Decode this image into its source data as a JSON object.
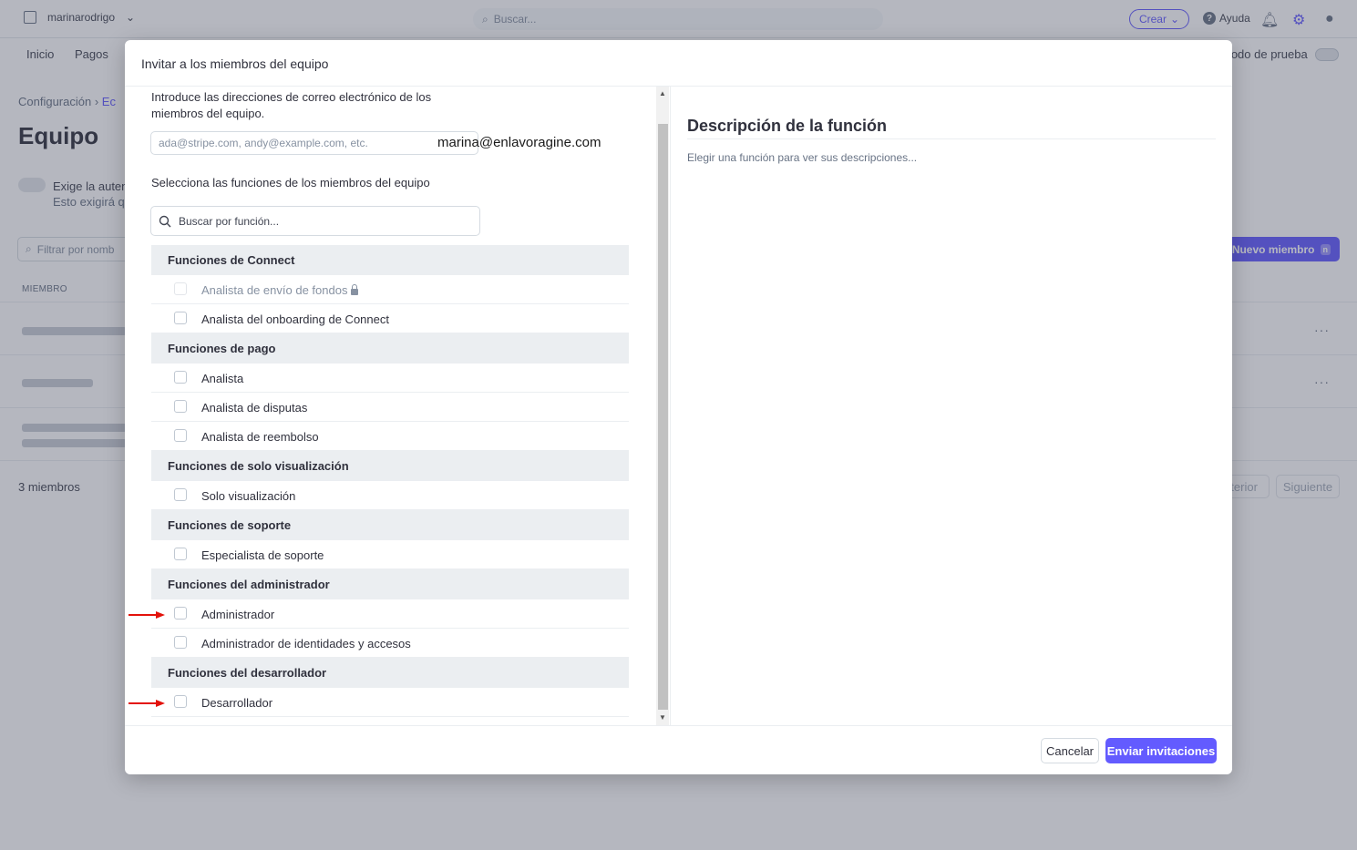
{
  "topbar": {
    "account_name": "marinarodrigo",
    "search_placeholder": "Buscar...",
    "create_label": "Crear",
    "help_label": "Ayuda"
  },
  "nav": {
    "items": [
      "Inicio",
      "Pagos"
    ],
    "test_mode_label": "Modo de prueba"
  },
  "page": {
    "breadcrumb_root": "Configuración",
    "breadcrumb_current": "Ec",
    "title": "Equipo",
    "auth_line1": "Exige la auten",
    "auth_line2": "Esto exigirá qu",
    "filter_placeholder": "Filtrar por nomb",
    "new_member_label": "Nuevo miembro",
    "new_member_shortcut": "n",
    "member_column": "MIEMBRO",
    "members_count": "3 miembros",
    "prev_label": "nterior",
    "next_label": "Siguiente"
  },
  "modal": {
    "title": "Invitar a los miembros del equipo",
    "intro": "Introduce las direcciones de correo electrónico de los miembros del equipo.",
    "email_placeholder": "ada@stripe.com, andy@example.com, etc.",
    "email_typed": "marina@enlavoragine.com",
    "select_label": "Selecciona las funciones de los miembros del equipo",
    "role_search_placeholder": "Buscar por función...",
    "groups": [
      {
        "name": "Funciones de Connect",
        "roles": [
          "Analista de envío de fondos",
          "Analista del onboarding de Connect"
        ]
      },
      {
        "name": "Funciones de pago",
        "roles": [
          "Analista",
          "Analista de disputas",
          "Analista de reembolso"
        ]
      },
      {
        "name": "Funciones de solo visualización",
        "roles": [
          "Solo visualización"
        ]
      },
      {
        "name": "Funciones de soporte",
        "roles": [
          "Especialista de soporte"
        ]
      },
      {
        "name": "Funciones del administrador",
        "roles": [
          "Administrador",
          "Administrador de identidades y accesos"
        ]
      },
      {
        "name": "Funciones del desarrollador",
        "roles": [
          "Desarrollador"
        ]
      }
    ],
    "description_title": "Descripción de la función",
    "description_text": "Elegir una función para ver sus descripciones...",
    "cancel_label": "Cancelar",
    "send_label": "Enviar invitaciones"
  },
  "colors": {
    "accent": "#635bff",
    "annotation_arrow": "#e3120b"
  }
}
